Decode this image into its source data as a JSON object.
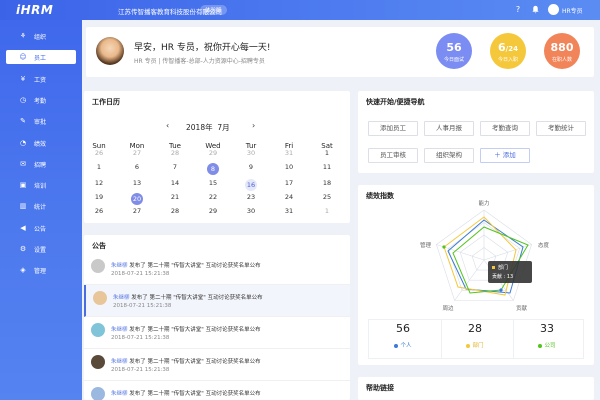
{
  "app": {
    "logo": "iHRM",
    "company": "江苏传智播客教育科技股份有限公司",
    "trial_badge": "体验版",
    "user": "HR专员"
  },
  "sidebar": {
    "items": [
      {
        "label": "组织",
        "icon": "org-icon",
        "active": false
      },
      {
        "label": "员工",
        "icon": "employee-icon",
        "active": true
      },
      {
        "label": "工资",
        "icon": "salary-icon",
        "active": false
      },
      {
        "label": "考勤",
        "icon": "attendance-icon",
        "active": false
      },
      {
        "label": "审批",
        "icon": "approval-icon",
        "active": false
      },
      {
        "label": "绩效",
        "icon": "performance-icon",
        "active": false
      },
      {
        "label": "招聘",
        "icon": "recruit-icon",
        "active": false
      },
      {
        "label": "培训",
        "icon": "training-icon",
        "active": false
      },
      {
        "label": "统计",
        "icon": "stats-icon",
        "active": false
      },
      {
        "label": "公告",
        "icon": "announce-icon",
        "active": false
      },
      {
        "label": "设置",
        "icon": "settings-icon",
        "active": false
      },
      {
        "label": "管理",
        "icon": "manage-icon",
        "active": false
      }
    ]
  },
  "profile": {
    "greeting": "早安，HR 专员，祝你开心每一天!",
    "subline": "HR 专员 | 传智播客-总部-人力资源中心-招聘专员",
    "stats": [
      {
        "num": "56",
        "label": "今日面试",
        "color": "#7b8cf2"
      },
      {
        "num_main": "6",
        "num_sub": "/24",
        "label": "今日入职",
        "color": "#f5c73a"
      },
      {
        "num": "880",
        "label": "在职人数",
        "color": "#f2845a"
      }
    ]
  },
  "calendar": {
    "title": "工作日历",
    "year": "2018年",
    "month": "7月",
    "prev": "‹",
    "next": "›",
    "weekdays": [
      "Sun",
      "Mon",
      "Tue",
      "Wed",
      "Tur",
      "Fri",
      "Sat"
    ],
    "weeks": [
      [
        "26",
        "27",
        "28",
        "29",
        "30",
        "31",
        "1"
      ],
      [
        "1",
        "6",
        "7",
        "8",
        "9",
        "10",
        "11"
      ],
      [
        "12",
        "13",
        "14",
        "15",
        "16",
        "17",
        "18"
      ],
      [
        "19",
        "20",
        "21",
        "22",
        "23",
        "24",
        "25"
      ],
      [
        "26",
        "27",
        "28",
        "29",
        "30",
        "31",
        "1"
      ]
    ]
  },
  "announcements": {
    "title": "公告",
    "items": [
      {
        "who": "朱继柳",
        "text": " 发布了 第二十期 \"传智大讲堂\" 互动讨论获奖名单公布",
        "time": "2018-07-21 15:21:38"
      },
      {
        "who": "朱继柳",
        "text": " 发布了 第二十期 \"传智大讲堂\" 互动讨论获奖名单公布",
        "time": "2018-07-21 15:21:38"
      },
      {
        "who": "朱继柳",
        "text": " 发布了 第二十期 \"传智大讲堂\" 互动讨论获奖名单公布",
        "time": "2018-07-21 15:21:38"
      },
      {
        "who": "朱继柳",
        "text": " 发布了 第二十期 \"传智大讲堂\" 互动讨论获奖名单公布",
        "time": "2018-07-21 15:21:38"
      },
      {
        "who": "朱继柳",
        "text": " 发布了 第二十期 \"传智大讲堂\" 互动讨论获奖名单公布",
        "time": ""
      }
    ]
  },
  "quicknav": {
    "title": "快速开始/便捷导航",
    "buttons": [
      "添加员工",
      "人事月报",
      "考勤查询",
      "考勤统计",
      "员工审核",
      "组织架构",
      "＋ 添加"
    ]
  },
  "performance": {
    "title": "绩效指数",
    "axes": [
      "能力",
      "态度",
      "贡献",
      "周边",
      "管理"
    ],
    "tooltip": {
      "title": "部门",
      "line": "贡献 : 13"
    },
    "summary": [
      {
        "num": "56",
        "label": "个人",
        "color": "#3a7bd5"
      },
      {
        "num": "28",
        "label": "部门",
        "color": "#f5c73a"
      },
      {
        "num": "33",
        "label": "公司",
        "color": "#52c41a"
      }
    ]
  },
  "help": {
    "title": "帮助链接"
  }
}
